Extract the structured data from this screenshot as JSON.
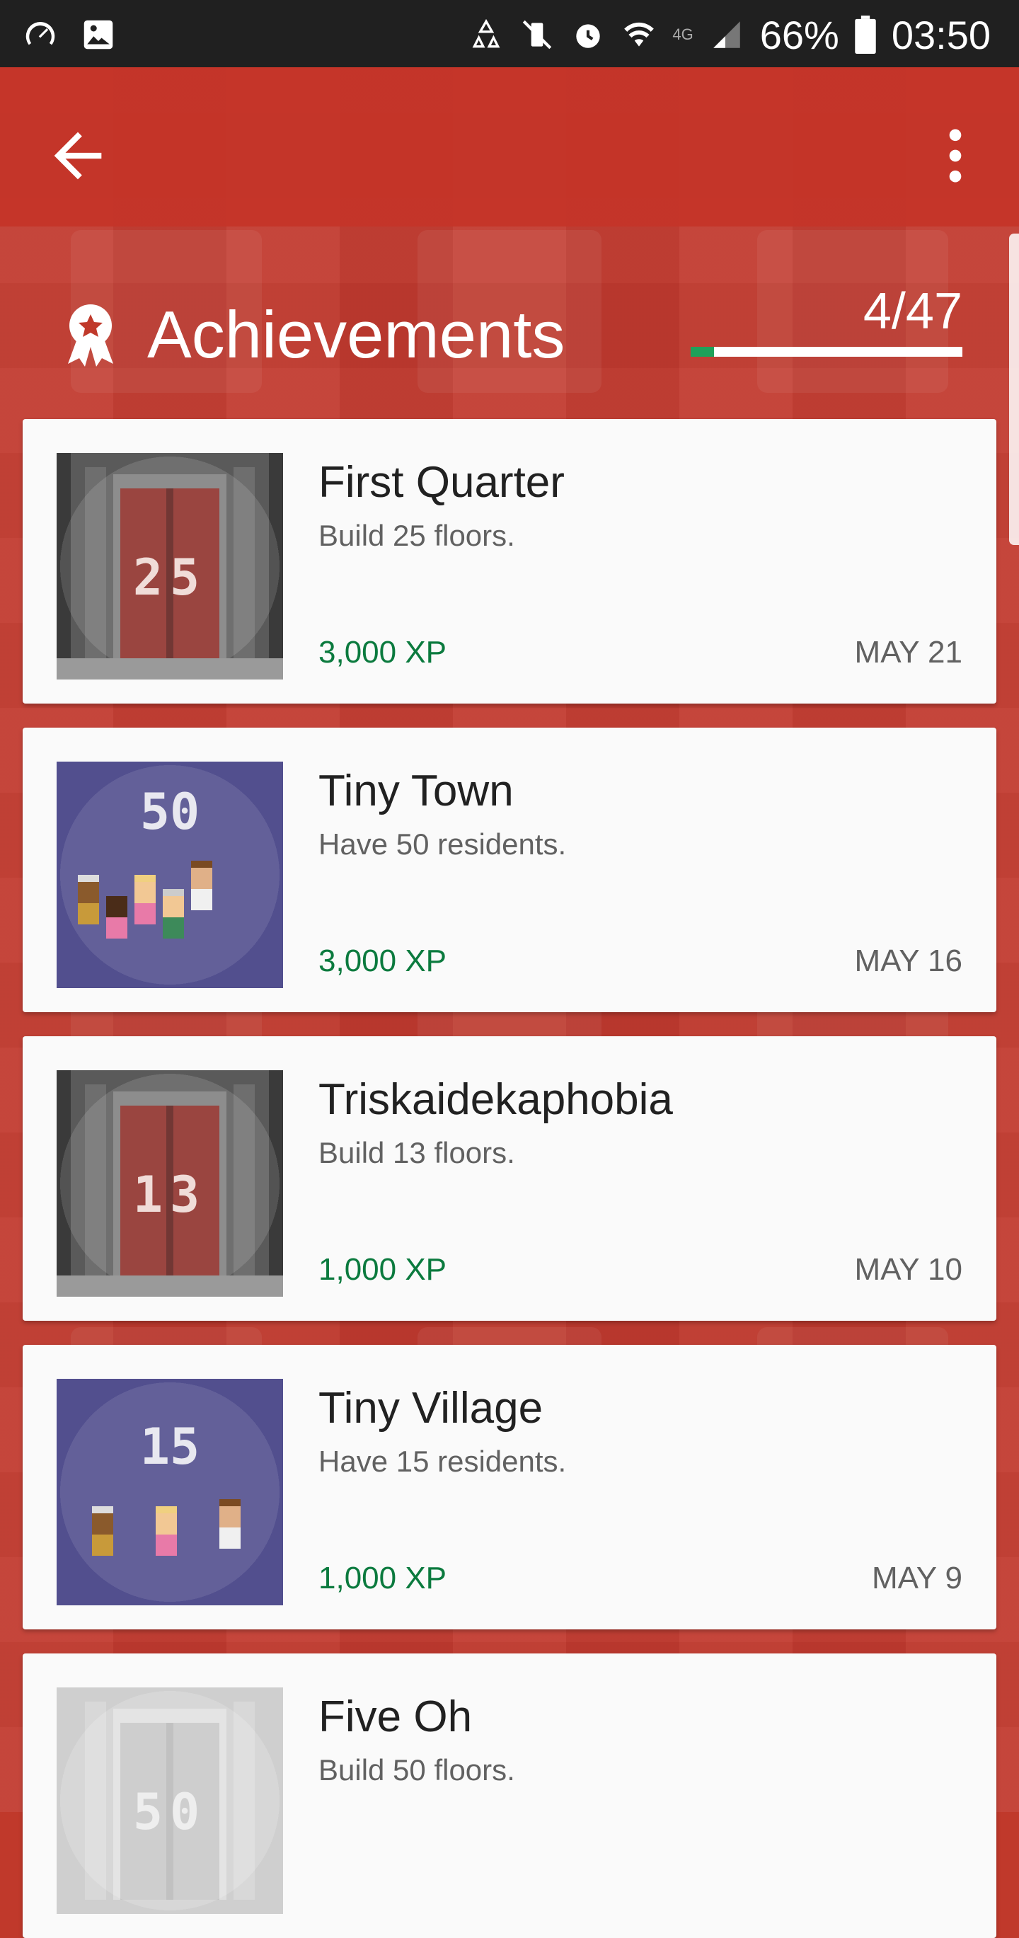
{
  "status_bar": {
    "battery": "66%",
    "time": "03:50",
    "network": "4G"
  },
  "app_bar": {
    "back_icon": "arrow-left-icon",
    "menu_icon": "more-vert-icon"
  },
  "header": {
    "title": "Achievements",
    "icon": "award-ribbon-icon",
    "progress_text": "4/47",
    "unlocked": 4,
    "total": 47
  },
  "colors": {
    "accent_red": "#c0392b",
    "xp_green": "#0b7a3e",
    "progress_green": "#1fa15a"
  },
  "achievements": [
    {
      "title": "First Quarter",
      "description": "Build 25 floors.",
      "xp": "3,000 XP",
      "date": "MAY 21",
      "badge": "elevator-25"
    },
    {
      "title": "Tiny Town",
      "description": "Have 50 residents.",
      "xp": "3,000 XP",
      "date": "MAY 16",
      "badge": "residents-50"
    },
    {
      "title": "Triskaidekaphobia",
      "description": "Build 13 floors.",
      "xp": "1,000 XP",
      "date": "MAY 10",
      "badge": "elevator-13"
    },
    {
      "title": "Tiny Village",
      "description": "Have 15 residents.",
      "xp": "1,000 XP",
      "date": "MAY 9",
      "badge": "residents-15"
    },
    {
      "title": "Five Oh",
      "description": "Build 50 floors.",
      "xp": "",
      "date": "",
      "badge": "elevator-50-locked"
    }
  ]
}
